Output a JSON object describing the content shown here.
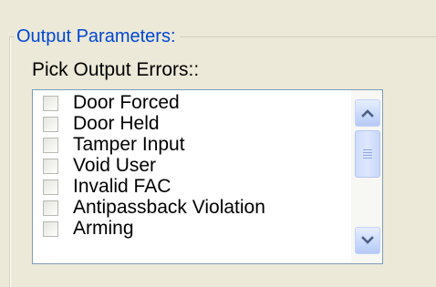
{
  "group": {
    "title": "Output Parameters:"
  },
  "pick_label": "Pick Output Errors::",
  "list": {
    "items": [
      {
        "label": "Door Forced",
        "checked": false
      },
      {
        "label": "Door Held",
        "checked": false
      },
      {
        "label": "Tamper Input",
        "checked": false
      },
      {
        "label": "Void User",
        "checked": false
      },
      {
        "label": "Invalid FAC",
        "checked": false
      },
      {
        "label": "Antipassback Violation",
        "checked": false
      },
      {
        "label": "Arming",
        "checked": false
      }
    ]
  },
  "scrollbar": {
    "up_icon": "chevron-up-icon",
    "down_icon": "chevron-down-icon",
    "thumb_icon": "grip-icon"
  },
  "colors": {
    "group_title": "#0046d5",
    "window_bg": "#ece9d8",
    "list_border": "#7f9db9",
    "scroll_arrow": "#4d6185"
  }
}
